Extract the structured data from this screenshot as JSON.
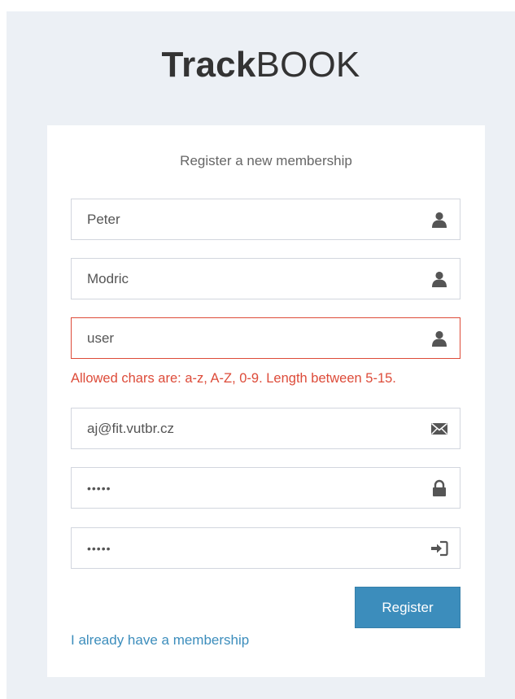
{
  "brand": {
    "bold": "Track",
    "light": "BOOK"
  },
  "form": {
    "title": "Register a new membership",
    "fields": [
      {
        "name": "first_name",
        "value": "Peter",
        "icon": "user-icon"
      },
      {
        "name": "last_name",
        "value": "Modric",
        "icon": "user-icon"
      },
      {
        "name": "username",
        "value": "user",
        "icon": "user-icon",
        "error": true
      },
      {
        "name": "email",
        "value": "aj@fit.vutbr.cz",
        "icon": "envelope-icon"
      },
      {
        "name": "password",
        "value": "•••••",
        "icon": "lock-icon"
      },
      {
        "name": "password_confirm",
        "value": "•••••",
        "icon": "log-in-icon"
      }
    ],
    "username_error": "Allowed chars are: a-z, A-Z, 0-9. Length between 5-15.",
    "submit_label": "Register",
    "login_link": "I already have a membership"
  },
  "colors": {
    "accent": "#3c8dbc",
    "error": "#dd4b39",
    "background": "#ecf0f5"
  }
}
